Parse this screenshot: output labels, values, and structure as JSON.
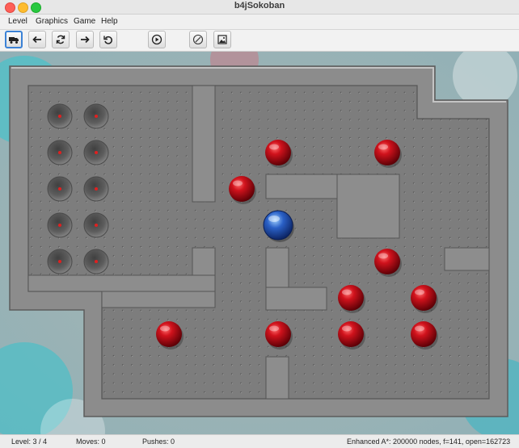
{
  "window": {
    "title": "b4jSokoban"
  },
  "menu": {
    "items": [
      "Level",
      "Graphics",
      "Game",
      "Help"
    ]
  },
  "toolbar": {
    "buttons": [
      {
        "icon": "truck-icon",
        "active": true
      },
      {
        "icon": "arrow-left-icon"
      },
      {
        "icon": "refresh-icon"
      },
      {
        "icon": "arrow-right-icon"
      },
      {
        "icon": "undo-icon"
      },
      {
        "icon": "play-circle-icon"
      },
      {
        "icon": "gauge-icon"
      },
      {
        "icon": "image-icon"
      }
    ]
  },
  "board": {
    "colors": {
      "floor": "#7d7d7d",
      "wall": "#8c8c8c",
      "box": "#c0141c",
      "player": "#2a60c6",
      "goal": "#707070"
    },
    "cols": 13,
    "rows": 9,
    "goals": [
      [
        0,
        0
      ],
      [
        1,
        0
      ],
      [
        0,
        1
      ],
      [
        1,
        1
      ],
      [
        0,
        2
      ],
      [
        1,
        2
      ],
      [
        0,
        3
      ],
      [
        1,
        3
      ],
      [
        0,
        4
      ],
      [
        1,
        4
      ]
    ],
    "boxes": [
      [
        6,
        1
      ],
      [
        9,
        1
      ],
      [
        5,
        2
      ],
      [
        9,
        4
      ],
      [
        8,
        5
      ],
      [
        10,
        5
      ],
      [
        3,
        6
      ],
      [
        6,
        6
      ],
      [
        8,
        6
      ],
      [
        10,
        6
      ]
    ],
    "player": [
      6,
      3
    ]
  },
  "status": {
    "level": "Level: 3 / 4",
    "moves": "Moves: 0",
    "pushes": "Pushes: 0",
    "solver": "Enhanced A*: 200000 nodes, f=141, open=162723"
  }
}
